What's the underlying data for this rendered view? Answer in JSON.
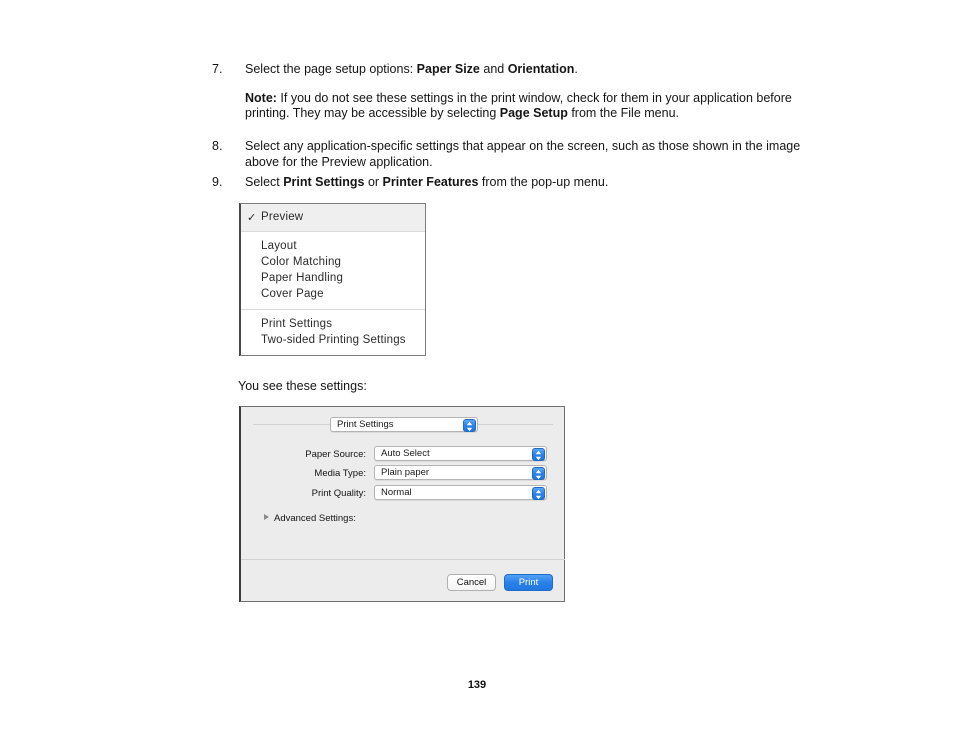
{
  "document": {
    "page_number": "139",
    "steps": [
      {
        "number": "7.",
        "lines": [
          {
            "segments": [
              {
                "text": "Select the page setup options: ",
                "bold": false
              },
              {
                "text": "Paper Size",
                "bold": true
              },
              {
                "text": " and ",
                "bold": false
              },
              {
                "text": "Orientation",
                "bold": true
              },
              {
                "text": ".",
                "bold": false
              }
            ]
          },
          {
            "spaced": true,
            "segments": [
              {
                "text": "Note:",
                "bold": true
              },
              {
                "text": " If you do not see these settings in the print window, check for them in your application before printing. They may be accessible by selecting ",
                "bold": false
              },
              {
                "text": "Page Setup",
                "bold": true
              },
              {
                "text": " from the File menu.",
                "bold": false
              }
            ]
          }
        ]
      },
      {
        "number": "8.",
        "lines": [
          {
            "segments": [
              {
                "text": "Select any application-specific settings that appear on the screen, such as those shown in the image above for the Preview application.",
                "bold": false
              }
            ]
          }
        ]
      },
      {
        "number": "9.",
        "lines": [
          {
            "segments": [
              {
                "text": "Select ",
                "bold": false
              },
              {
                "text": "Print Settings",
                "bold": true
              },
              {
                "text": " or ",
                "bold": false
              },
              {
                "text": "Printer Features",
                "bold": true
              },
              {
                "text": " from the pop-up menu.",
                "bold": false
              }
            ]
          }
        ]
      }
    ],
    "caption": "You see these settings:"
  },
  "popup_menu": {
    "checked_item": {
      "label": "Preview",
      "check_glyph": "✓"
    },
    "groups": [
      {
        "items": [
          "Layout",
          "Color Matching",
          "Paper Handling",
          "Cover Page"
        ]
      },
      {
        "items": [
          "Print Settings",
          "Two-sided Printing Settings"
        ]
      }
    ]
  },
  "print_dialog": {
    "pane_select": {
      "value": "Print Settings"
    },
    "rows": [
      {
        "label": "Paper Source:",
        "value": "Auto Select"
      },
      {
        "label": "Media Type:",
        "value": "Plain paper"
      },
      {
        "label": "Print Quality:",
        "value": "Normal"
      }
    ],
    "advanced": {
      "label": "Advanced Settings:",
      "disclosure": "collapsed"
    },
    "buttons": {
      "cancel": "Cancel",
      "print": "Print"
    },
    "colors": {
      "accent_blue": "#2a80e8",
      "dialog_bg": "#ececec"
    }
  }
}
